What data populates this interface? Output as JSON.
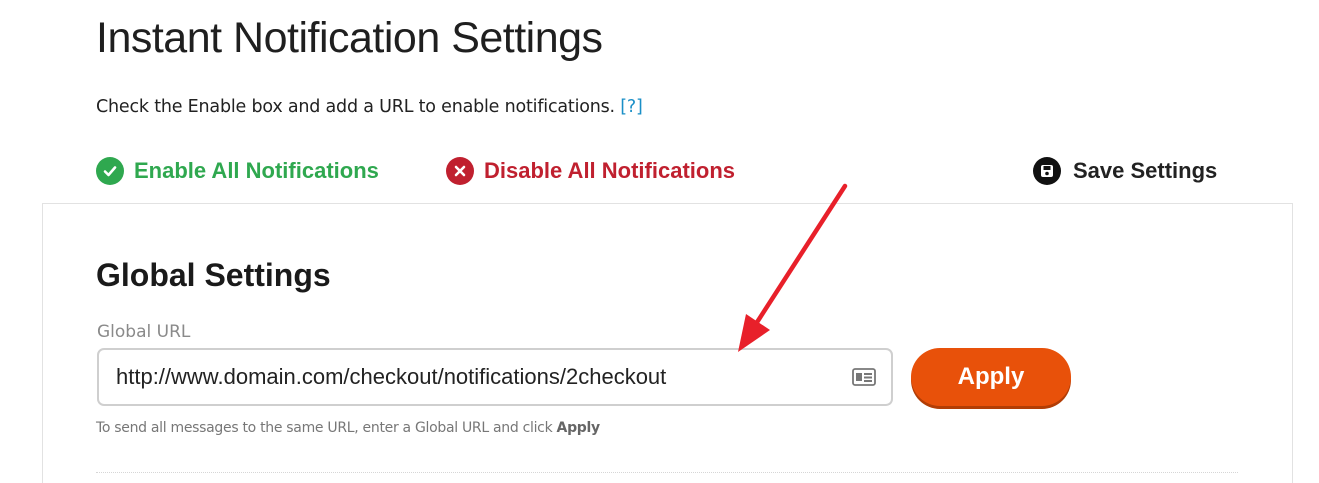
{
  "page": {
    "title": "Instant Notification Settings",
    "intro_text": "Check the Enable box and add a URL to enable notifications.",
    "help_link": "[?]"
  },
  "actions": {
    "enable_all": "Enable All Notifications",
    "disable_all": "Disable All Notifications",
    "save": "Save Settings"
  },
  "global_settings": {
    "title": "Global Settings",
    "url_label": "Global URL",
    "url_value": "http://www.domain.com/checkout/notifications/2checkout",
    "apply_label": "Apply",
    "hint_prefix": "To send all messages to the same URL, enter a Global URL and click",
    "hint_bold": "Apply"
  },
  "icons": {
    "enable": "check-circle-icon",
    "disable": "x-circle-icon",
    "save": "floppy-disk-icon",
    "field": "contact-card-icon",
    "annotation": "red-arrow-icon"
  },
  "colors": {
    "enable": "#2fa84f",
    "disable": "#c0202f",
    "apply": "#e8510a",
    "link": "#1a8fc7",
    "annotation": "#e8202a"
  }
}
